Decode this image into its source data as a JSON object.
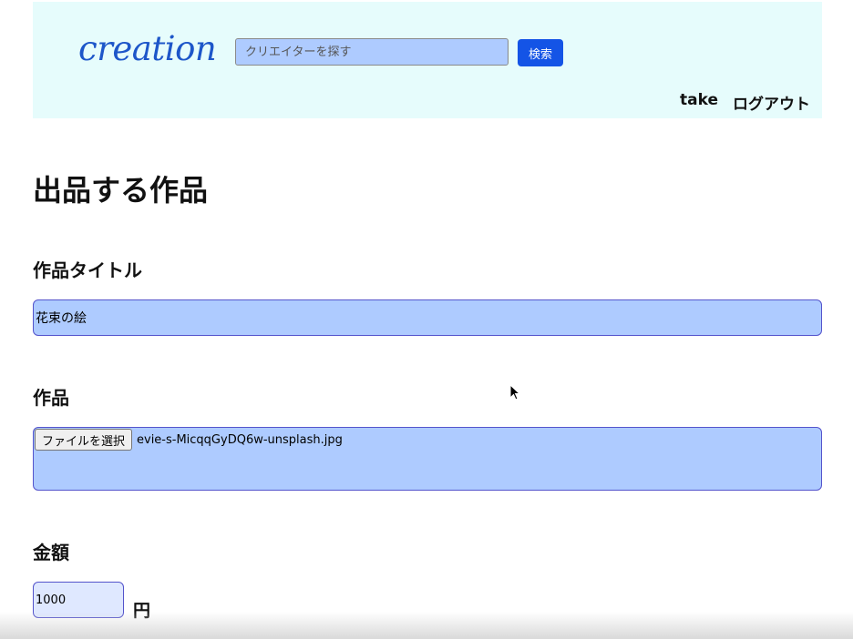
{
  "header": {
    "logo": "creation",
    "search": {
      "placeholder": "クリエイターを探す",
      "value": ""
    },
    "search_button": "検索",
    "nav": {
      "user": "take",
      "logout": "ログアウト"
    }
  },
  "page": {
    "title": "出品する作品"
  },
  "form": {
    "title_label": "作品タイトル",
    "title_value": "花束の絵",
    "work_label": "作品",
    "file_button": "ファイルを選択",
    "file_name": "evie-s-MicqqGyDQ6w-unsplash.jpg",
    "price_label": "金額",
    "price_value": "1000",
    "price_unit": "円"
  },
  "icons": {
    "cursor": "mouse-pointer-icon"
  },
  "colors": {
    "header_bg": "#e6fcfc",
    "logo": "#1d56c9",
    "input_bg": "#aecbff",
    "search_button": "#1454e6",
    "input_border": "#5454cc"
  }
}
